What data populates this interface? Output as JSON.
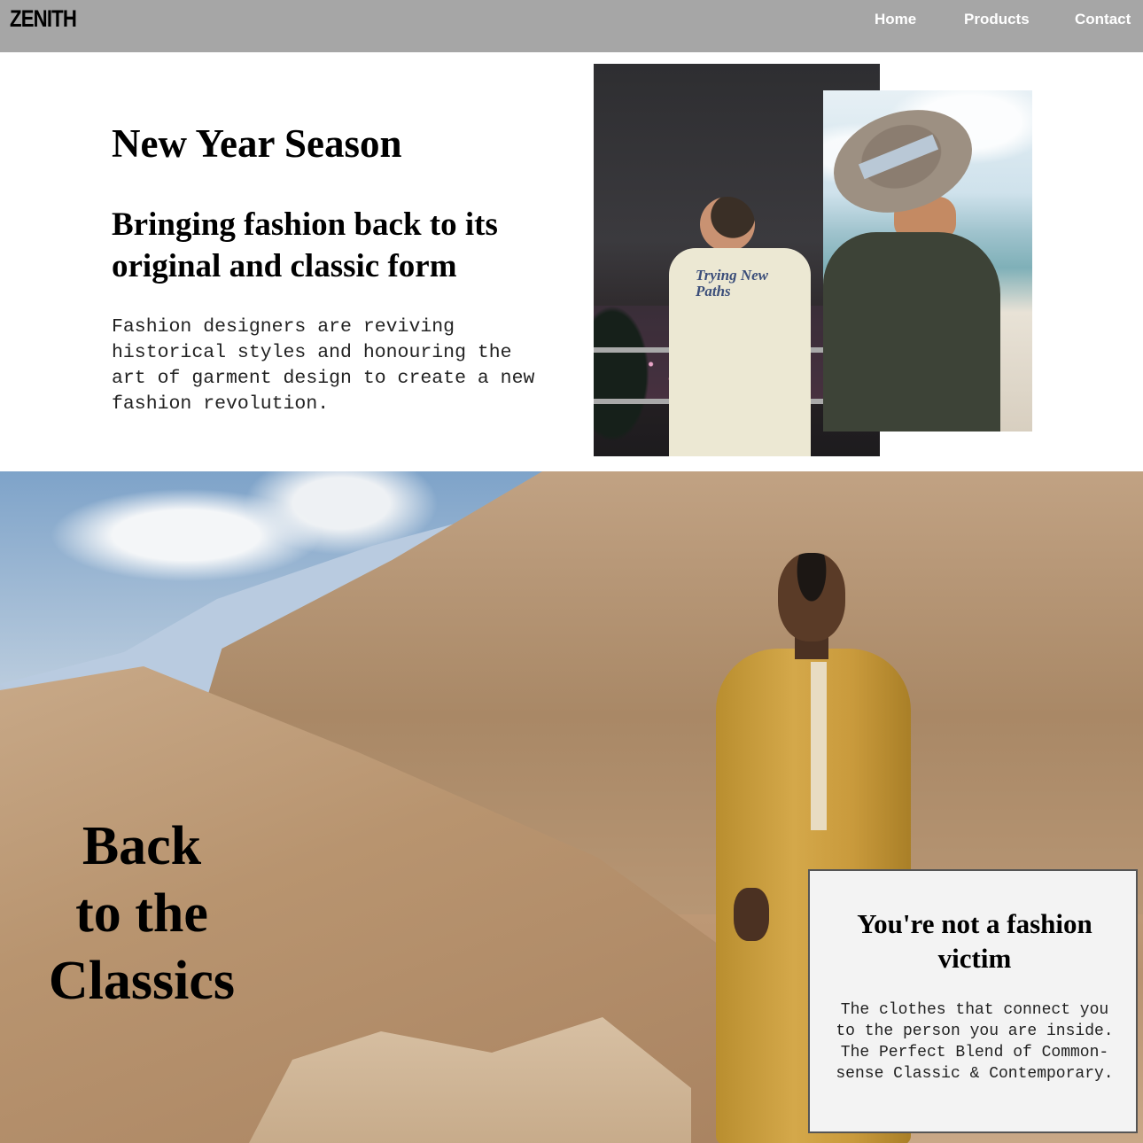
{
  "header": {
    "logo": "ZENITH",
    "nav": {
      "home": "Home",
      "products": "Products",
      "contact": "Contact"
    }
  },
  "hero": {
    "title": "New Year Season",
    "subtitle": "Bringing fashion back to its original and classic form",
    "body": "Fashion designers are reviving historical styles and honouring the art of garment design to create a new fashion revolution.",
    "shirt_print": "Trying New Paths"
  },
  "classics": {
    "title_line1": "Back",
    "title_line2": "to the",
    "title_line3": "Classics",
    "card": {
      "title": "You're not a fashion victim",
      "text": "The clothes that connect you to the person you are inside. The Perfect Blend of Common-sense Classic & Contemporary."
    }
  },
  "colors": {
    "navbar": "#a6a6a6",
    "nav_text": "#ffffff",
    "card_bg": "#f3f3f3"
  }
}
